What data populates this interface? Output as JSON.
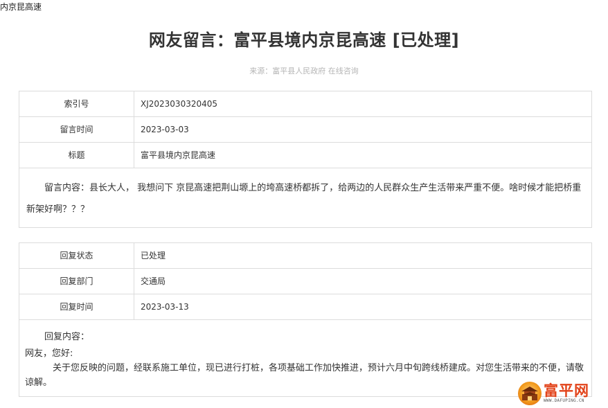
{
  "tab_title": "内京昆高速",
  "page_title": "网友留言：富平县境内京昆高速 [已处理]",
  "source": "来源：富平县人民政府 在线咨询",
  "message": {
    "rows": [
      {
        "label": "索引号",
        "value": "XJ2023030320405"
      },
      {
        "label": "留言时间",
        "value": "2023-03-03"
      },
      {
        "label": "标题",
        "value": "富平县境内京昆高速"
      }
    ],
    "content": "留言内容：县长大人， 我想问下 京昆高速把荆山塬上的垮高速桥都拆了，给两边的人民群众生产生活带来严重不便。啥时候才能把桥重新架好啊？？？"
  },
  "reply": {
    "rows": [
      {
        "label": "回复状态",
        "value": "已处理"
      },
      {
        "label": "回复部门",
        "value": "交通局"
      },
      {
        "label": "回复时间",
        "value": "2023-03-13"
      }
    ],
    "heading": "回复内容：",
    "greeting": "网友，您好:",
    "body": "关于您反映的问题，经联系施工单位，现已进行打桩，各项基础工作加快推进，预计六月中旬跨线桥建成。对您生活带来的不便，请敬谅解。"
  },
  "logo": {
    "name": "富平网",
    "url": "WWW.DAFUPING.CN",
    "color": "#e2431a"
  }
}
